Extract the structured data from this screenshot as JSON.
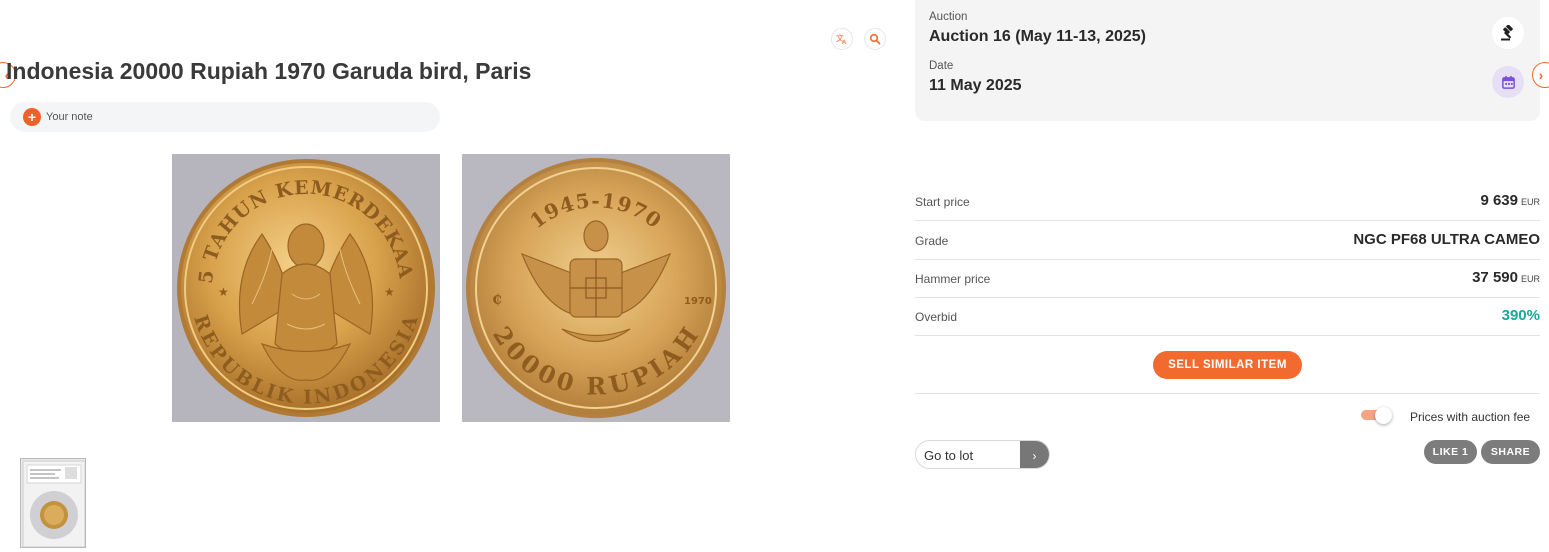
{
  "lot": {
    "title": "Indonesia 20000 Rupiah 1970 Garuda bird, Paris",
    "note_label": "Your note"
  },
  "coin": {
    "obverse": {
      "legend_top": "25 TAHUN KEMERDEKAAN",
      "legend_bottom": "REPUBLIK INDONESIA"
    },
    "reverse": {
      "legend_top": "1945-1970",
      "legend_bottom": "20000 RUPIAH",
      "year": "1970"
    }
  },
  "auction": {
    "label": "Auction",
    "value": "Auction 16 (May 11-13, 2025)",
    "date_label": "Date",
    "date_value": "11 May 2025"
  },
  "details": [
    {
      "label": "Start price",
      "value": "9 639",
      "currency": "EUR"
    },
    {
      "label": "Grade",
      "value": "NGC PF68 ULTRA CAMEO",
      "currency": ""
    },
    {
      "label": "Hammer price",
      "value": "37 590",
      "currency": "EUR"
    },
    {
      "label": "Overbid",
      "value": "390%",
      "currency": ""
    }
  ],
  "actions": {
    "sell_similar": "SELL SIMILAR ITEM",
    "prices_with_fee": "Prices with auction fee",
    "go_to_lot": "Go to lot",
    "go_arrow": "›",
    "like": "LIKE 1",
    "share": "SHARE"
  },
  "nav": {
    "prev": "‹",
    "next": "›"
  },
  "colors": {
    "accent": "#f26a2e",
    "overbid": "#1aa89a",
    "calendar": "#7b52d6"
  },
  "icons": [
    "translate-icon",
    "zoom-icon",
    "gavel-icon",
    "calendar-icon",
    "plus-icon",
    "chevron-left-icon",
    "chevron-right-icon"
  ]
}
